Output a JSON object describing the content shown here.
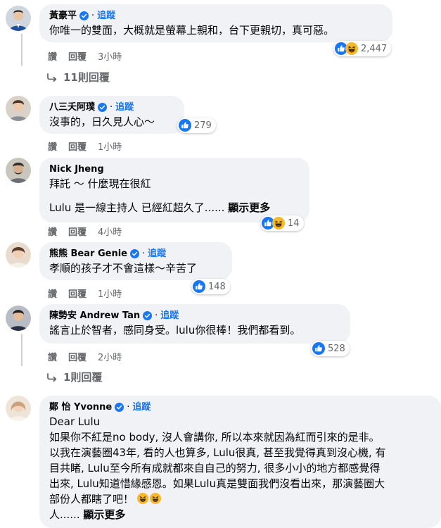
{
  "ui": {
    "follow_label": "追蹤",
    "like_label": "讚",
    "reply_label": "回覆",
    "see_more_label": "顯示更多"
  },
  "comments": [
    {
      "name": "黃豪平",
      "verified": true,
      "lines": [
        "你唯一的雙面，大概就是螢幕上親和，台下更親切，真可惡。"
      ],
      "time": "3小時",
      "reaction_icons": [
        "like-icon",
        "haha-icon"
      ],
      "reaction_count": "2,447",
      "replies_label": "11則回覆"
    },
    {
      "name": "八三夭阿璞",
      "verified": true,
      "lines": [
        "沒事的，日久見人心～"
      ],
      "time": "1小時",
      "reaction_icons": [
        "like-icon"
      ],
      "reaction_count": "279"
    },
    {
      "name": "Nick Jheng",
      "verified": false,
      "lines": [
        "拜託 ～ 什麼現在很紅",
        "",
        "Lulu 是一線主持人 已經紅超久了......"
      ],
      "time": "4小時",
      "reaction_icons": [
        "like-icon",
        "haha-icon"
      ],
      "reaction_count": "14"
    },
    {
      "name": "熊熊 Bear Genie",
      "verified": true,
      "lines": [
        "孝順的孩子才不會這樣～辛苦了"
      ],
      "time": "1小時",
      "reaction_icons": [
        "like-icon"
      ],
      "reaction_count": "148"
    },
    {
      "name": "陳勢安 Andrew Tan",
      "verified": true,
      "lines": [
        "謠言止於智者，感同身受。lulu你很棒！我們都看到。"
      ],
      "time": "2小時",
      "reaction_icons": [
        "like-icon"
      ],
      "reaction_count": "528",
      "replies_label": "1則回覆"
    },
    {
      "name": "鄭 怡 Yvonne",
      "verified": true,
      "lines": [
        "Dear Lulu",
        "如果你不紅是no body, 沒人會講你, 所以本來就因為紅而引來的是非。",
        "以我在演藝圈43年, 看的人也算多, Lulu很真, 甚至我覺得真到沒心機, 有",
        "目共睹, Lulu至今所有成就都來自自己的努力, 很多小小的地方都感覺得",
        "出來, Lulu知道惜緣感恩。如果Lulu真是雙面我們沒看出來，那演藝圈大",
        "部份人都瞎了吧！",
        "人......"
      ]
    }
  ],
  "colors": {
    "bubble": "#f0f2f5",
    "link_blue": "#1877f2",
    "meta_gray": "#65676b",
    "haha_yellow": "#f7b928"
  }
}
